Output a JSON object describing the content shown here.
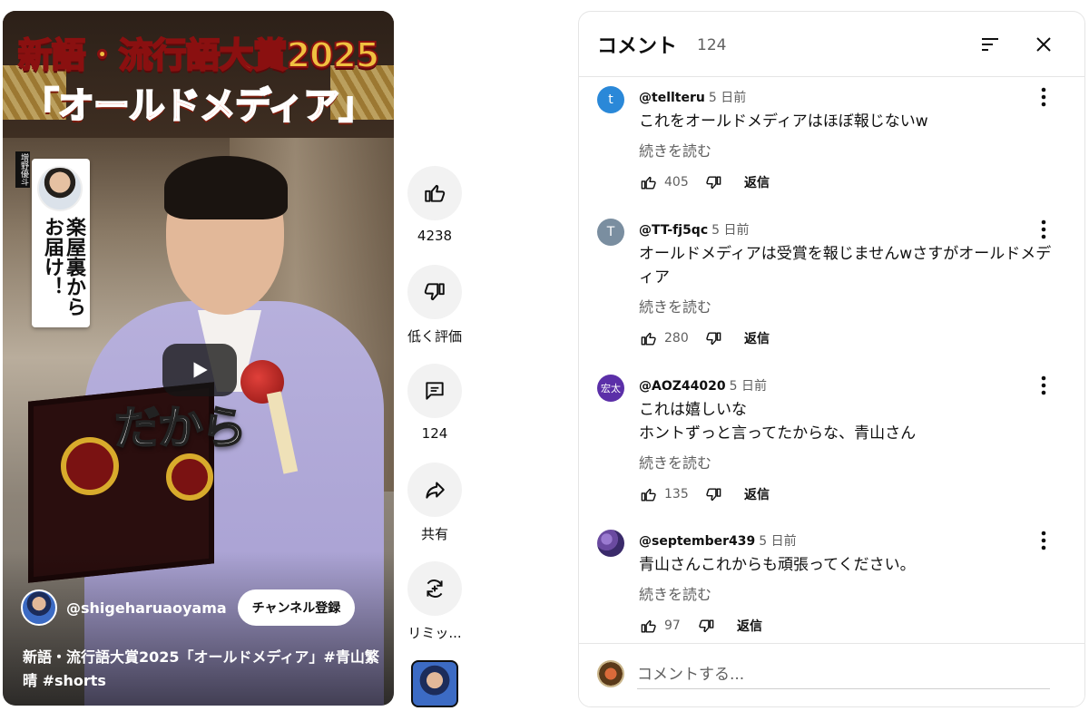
{
  "video": {
    "overlay_title_line1": "新語・流行語大賞2025",
    "overlay_title_line2": "「オールドメディア」",
    "card_text": "楽屋裏からお届け！",
    "card_tag": "増野優斗",
    "caption_big": "だから",
    "channel_name": "@shigeharuaoyama",
    "subscribe_label": "チャンネル登録",
    "title": "新語・流行語大賞2025「オールドメディア」#青山繁晴 #shorts"
  },
  "actions": {
    "like_count": "4238",
    "dislike_label": "低く評価",
    "comment_count": "124",
    "share_label": "共有",
    "remix_label": "リミッ..."
  },
  "comments_panel": {
    "title": "コメント",
    "count": "124",
    "more_label": "続きを読む",
    "reply_label": "返信",
    "input_placeholder": "コメントする...",
    "comments": [
      {
        "avatar_letter": "t",
        "avatar_color": "#2a88d8",
        "author": "@tellteru",
        "time": "5 日前",
        "lines": [
          "これをオールドメディアはほぼ報じないw"
        ],
        "likes": "405"
      },
      {
        "avatar_letter": "T",
        "avatar_color": "#7a8ea0",
        "author": "@TT-fj5qc",
        "time": "5 日前",
        "lines": [
          "オールドメディアは受賞を報じませんwさすがオールドメディア"
        ],
        "likes": "280"
      },
      {
        "avatar_letter": "宏太",
        "avatar_color": "#5b2fa8",
        "author": "@AOZ44020",
        "time": "5 日前",
        "lines": [
          "これは嬉しいな",
          "ホントずっと言ってたからな、青山さん"
        ],
        "likes": "135"
      },
      {
        "avatar_letter": "",
        "avatar_color": "#6a4aa0",
        "author": "@september439",
        "time": "5 日前",
        "lines": [
          "青山さんこれからも頑張ってください。"
        ],
        "likes": "97"
      }
    ]
  }
}
